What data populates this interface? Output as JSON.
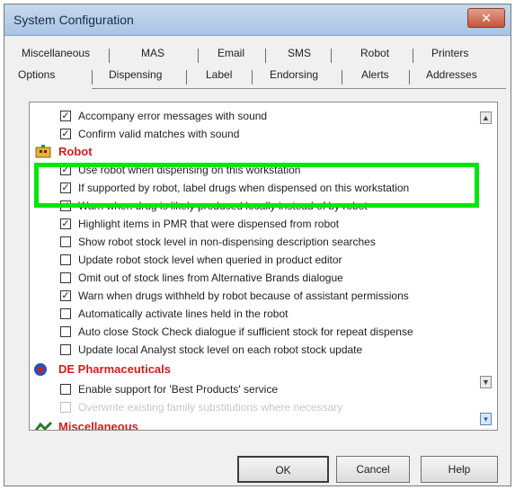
{
  "window": {
    "title": "System Configuration",
    "close_glyph": "✕"
  },
  "tabs": {
    "row1": [
      "Miscellaneous",
      "MAS",
      "Email",
      "SMS",
      "Robot",
      "Printers"
    ],
    "row2": [
      "Options",
      "Dispensing",
      "Label",
      "Endorsing",
      "Alerts",
      "Addresses"
    ],
    "active": "Options"
  },
  "options": {
    "row_top_1": {
      "label": "Accompany error messages with sound",
      "checked": true
    },
    "row_top_2": {
      "label": "Confirm valid matches with sound",
      "checked": true
    },
    "robot_header": {
      "label": "Robot",
      "icon": "robot-icon"
    },
    "robot_items": [
      {
        "label": "Use robot when dispensing on this workstation",
        "checked": true
      },
      {
        "label": "If supported by robot, label drugs when dispensed on this workstation",
        "checked": true
      },
      {
        "label": "Warn when drug is likely produced locally instead of by robot",
        "checked": true
      },
      {
        "label": "Highlight items in PMR that were dispensed from robot",
        "checked": true
      },
      {
        "label": "Show robot stock level in non-dispensing description searches",
        "checked": false
      },
      {
        "label": "Update robot stock level when queried in product editor",
        "checked": false
      },
      {
        "label": "Omit out of stock lines from Alternative Brands dialogue",
        "checked": false
      },
      {
        "label": "Warn when drugs withheld by robot because of assistant permissions",
        "checked": true
      },
      {
        "label": "Automatically activate lines held in the robot",
        "checked": false
      },
      {
        "label": "Auto close Stock Check dialogue if sufficient stock for repeat dispense",
        "checked": false
      },
      {
        "label": "Update local Analyst stock level on each robot stock update",
        "checked": false
      }
    ],
    "de_header": {
      "label": "DE Pharmaceuticals",
      "icon": "de-pharmaceuticals-icon"
    },
    "de_items": [
      {
        "label": "Enable support for 'Best Products' service",
        "checked": false
      },
      {
        "label": "Overwrite existing family substitutions where necessary",
        "checked": false,
        "disabled": true
      }
    ],
    "misc_header": {
      "label": "Miscellaneous",
      "icon": "miscellaneous-icon"
    }
  },
  "buttons": {
    "ok": "OK",
    "cancel": "Cancel",
    "help": "Help"
  },
  "colors": {
    "category_header": "#d21d1d",
    "highlight_box": "#00e60a"
  }
}
